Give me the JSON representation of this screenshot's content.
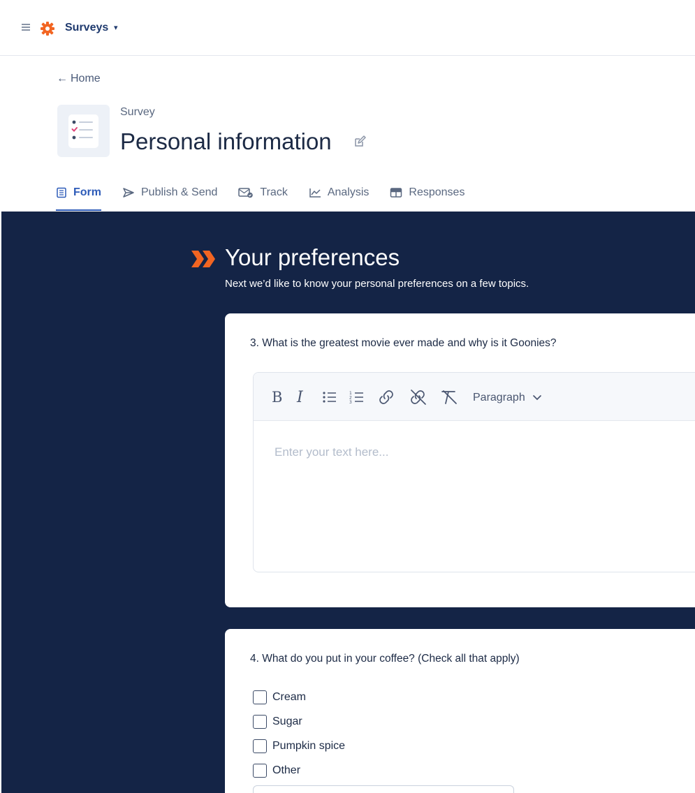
{
  "topbar": {
    "app_name": "Surveys",
    "brand_color": "#f26522"
  },
  "header": {
    "back_label": "Home",
    "survey_type": "Survey",
    "title": "Personal information"
  },
  "tabs": [
    {
      "label": "Form",
      "icon": "form-icon",
      "active": true
    },
    {
      "label": "Publish & Send",
      "icon": "send-icon",
      "active": false
    },
    {
      "label": "Track",
      "icon": "track-icon",
      "active": false
    },
    {
      "label": "Analysis",
      "icon": "analysis-icon",
      "active": false
    },
    {
      "label": "Responses",
      "icon": "table-icon",
      "active": false
    }
  ],
  "section": {
    "title": "Your preferences",
    "description": "Next we’d like to know your personal preferences on a few topics.",
    "accent_color": "#f26522",
    "background": "#142446"
  },
  "q3": {
    "question": "3. What is the greatest movie ever made and why is it Goonies?",
    "editor": {
      "bold": "B",
      "italic": "I",
      "paragraph_label": "Paragraph",
      "placeholder": "Enter your text here..."
    }
  },
  "q4": {
    "question": "4. What do you put in your coffee? (Check all that apply)",
    "options": [
      "Cream",
      "Sugar",
      "Pumpkin spice",
      "Other"
    ]
  }
}
